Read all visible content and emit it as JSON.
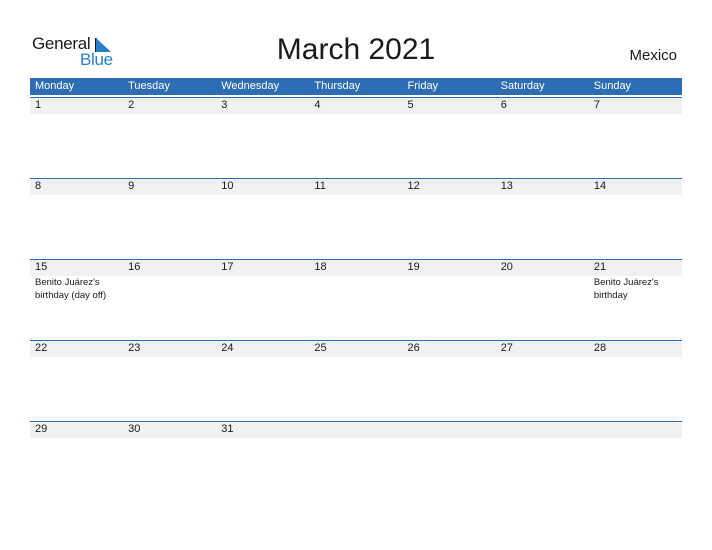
{
  "logo": {
    "word1": "General",
    "word2": "Blue"
  },
  "title": "March 2021",
  "country": "Mexico",
  "colors": {
    "header_bg": "#2d6db4",
    "date_strip_bg": "#f1f1f1",
    "logo_blue": "#2a7fc9"
  },
  "weekdays": [
    "Monday",
    "Tuesday",
    "Wednesday",
    "Thursday",
    "Friday",
    "Saturday",
    "Sunday"
  ],
  "weeks": [
    {
      "days": [
        {
          "num": "1",
          "holiday": ""
        },
        {
          "num": "2",
          "holiday": ""
        },
        {
          "num": "3",
          "holiday": ""
        },
        {
          "num": "4",
          "holiday": ""
        },
        {
          "num": "5",
          "holiday": ""
        },
        {
          "num": "6",
          "holiday": ""
        },
        {
          "num": "7",
          "holiday": ""
        }
      ]
    },
    {
      "days": [
        {
          "num": "8",
          "holiday": ""
        },
        {
          "num": "9",
          "holiday": ""
        },
        {
          "num": "10",
          "holiday": ""
        },
        {
          "num": "11",
          "holiday": ""
        },
        {
          "num": "12",
          "holiday": ""
        },
        {
          "num": "13",
          "holiday": ""
        },
        {
          "num": "14",
          "holiday": ""
        }
      ]
    },
    {
      "days": [
        {
          "num": "15",
          "holiday": "Benito Juárez's\nbirthday (day off)"
        },
        {
          "num": "16",
          "holiday": ""
        },
        {
          "num": "17",
          "holiday": ""
        },
        {
          "num": "18",
          "holiday": ""
        },
        {
          "num": "19",
          "holiday": ""
        },
        {
          "num": "20",
          "holiday": ""
        },
        {
          "num": "21",
          "holiday": "Benito Juárez's\nbirthday"
        }
      ]
    },
    {
      "days": [
        {
          "num": "22",
          "holiday": ""
        },
        {
          "num": "23",
          "holiday": ""
        },
        {
          "num": "24",
          "holiday": ""
        },
        {
          "num": "25",
          "holiday": ""
        },
        {
          "num": "26",
          "holiday": ""
        },
        {
          "num": "27",
          "holiday": ""
        },
        {
          "num": "28",
          "holiday": ""
        }
      ]
    },
    {
      "days": [
        {
          "num": "29",
          "holiday": ""
        },
        {
          "num": "30",
          "holiday": ""
        },
        {
          "num": "31",
          "holiday": ""
        },
        {
          "num": "",
          "holiday": ""
        },
        {
          "num": "",
          "holiday": ""
        },
        {
          "num": "",
          "holiday": ""
        },
        {
          "num": "",
          "holiday": ""
        }
      ]
    }
  ]
}
